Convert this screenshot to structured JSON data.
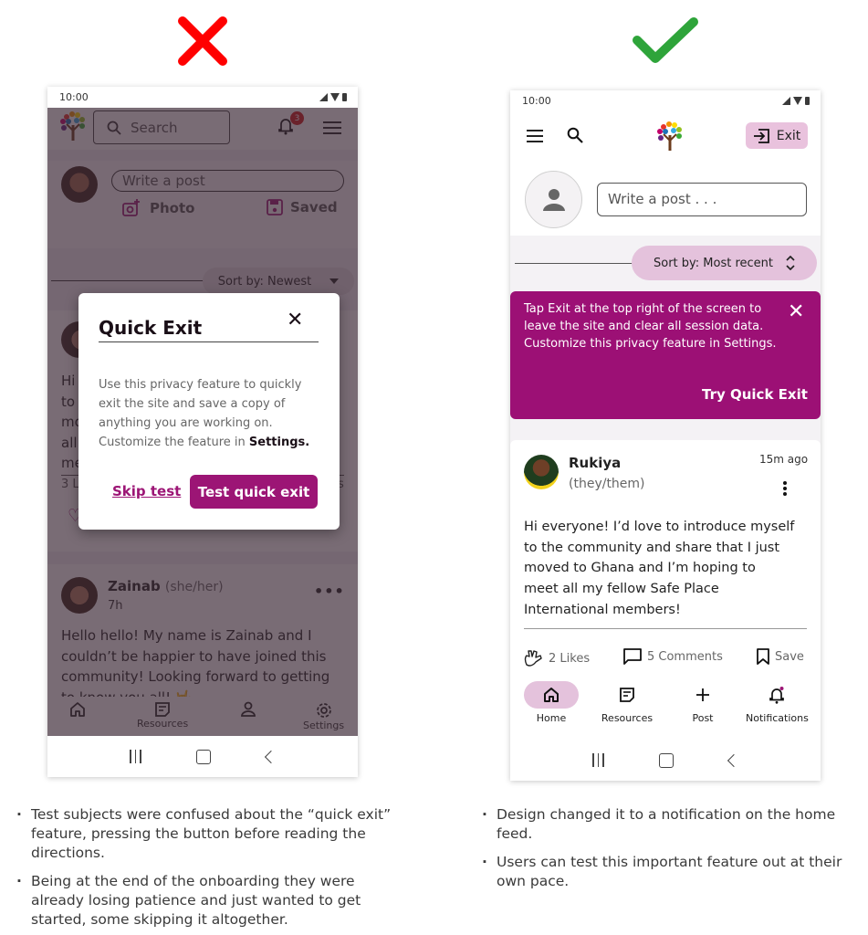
{
  "verdicts": {
    "left": {
      "icon": "x-mark-icon",
      "color": "#ff0000"
    },
    "right": {
      "icon": "check-mark-icon",
      "color": "#2ea43a"
    }
  },
  "colors": {
    "brand": "#9c1575",
    "brand_light": "#e4c2dc",
    "badge_red": "#cf1b1b"
  },
  "left_phone": {
    "status_time": "10:00",
    "search_placeholder": "Search",
    "notification_count": "3",
    "compose_placeholder": "Write a post",
    "photo_label": "Photo",
    "saved_label": "Saved",
    "sort_label": "Sort by: Newest",
    "post1": {
      "text": "Hi\nto\nmo\nall\nme",
      "likes_partial": "3 L",
      "comments_partial": "s"
    },
    "post2": {
      "name": "Zainab",
      "pronouns": "(she/her)",
      "time": "7h",
      "text": "Hello hello! My name is Zainab and I\ncouldn’t be happier to have joined this\ncommunity! Looking forward to getting\nto know you all! 🤟"
    },
    "bottom_nav": [
      {
        "label": "Home",
        "icon": "home-icon"
      },
      {
        "label": "Resources",
        "icon": "resources-icon"
      },
      {
        "label": "Profile",
        "icon": "profile-icon"
      },
      {
        "label": "Settings",
        "icon": "gear-icon"
      }
    ],
    "modal": {
      "title": "Quick Exit",
      "body": "Use this privacy feature to quickly exit the site and save a copy of anything you are working on. Customize the feature in ",
      "body_link": "Settings.",
      "skip_label": "Skip test",
      "test_label": "Test quick exit"
    }
  },
  "right_phone": {
    "status_time": "10:00",
    "exit_label": "Exit",
    "compose_placeholder": "Write a post . . .",
    "sort_label": "Sort by: Most recent",
    "notification": {
      "text": "Tap Exit at the top right of the screen to leave the site and clear all session data. Customize this privacy feature in Settings.",
      "cta": "Try Quick Exit"
    },
    "post": {
      "name": "Rukiya",
      "pronouns": "(they/them)",
      "time": "15m ago",
      "text": "Hi everyone! I’d love to introduce myself\nto the community and share that I just\nmoved to Ghana and I’m hoping to\nmeet all my fellow Safe Place\nInternational members!",
      "likes": "2 Likes",
      "comments": "5 Comments",
      "save": "Save"
    },
    "bottom_nav": [
      {
        "label": "Home",
        "icon": "home-icon",
        "active": true
      },
      {
        "label": "Resources",
        "icon": "resources-icon"
      },
      {
        "label": "Post",
        "icon": "plus-icon"
      },
      {
        "label": "Notifications",
        "icon": "bell-icon"
      }
    ]
  },
  "notes": {
    "left": [
      "Test subjects were confused about the “quick exit” feature, pressing the button before reading the directions.",
      "Being at the end of the onboarding they were already losing patience and just wanted to get started, some skipping it altogether."
    ],
    "right": [
      "Design changed it to a notification on the home feed.",
      "Users can test this important feature out at their own pace."
    ]
  }
}
